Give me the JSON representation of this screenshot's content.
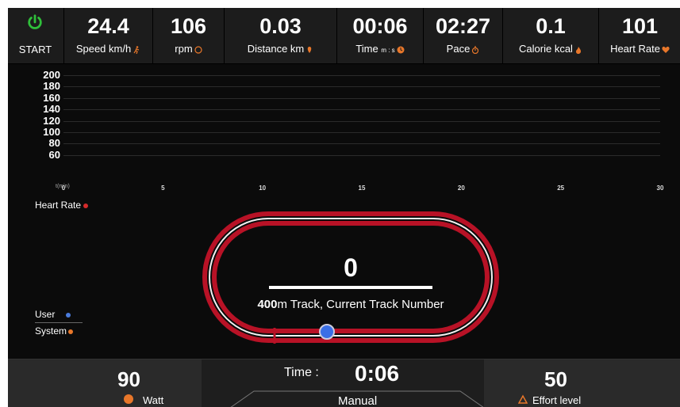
{
  "start": {
    "label": "START"
  },
  "stats": [
    {
      "value": "24.4",
      "label": "Speed km/h",
      "icon": "runner-icon"
    },
    {
      "value": "106",
      "label": "rpm",
      "icon": "rpm-icon"
    },
    {
      "value": "0.03",
      "label": "Distance km",
      "icon": "distance-icon"
    },
    {
      "value": "00:06",
      "label": "Time",
      "label_sub": "m : s",
      "icon": "clock-icon"
    },
    {
      "value": "02:27",
      "label": "Pace",
      "icon": "stopwatch-icon"
    },
    {
      "value": "0.1",
      "label": "Calorie kcal",
      "icon": "flame-icon"
    },
    {
      "value": "101",
      "label": "Heart Rate",
      "icon": "heart-icon"
    }
  ],
  "chart_data": {
    "type": "line",
    "ylabel": "Heart Rate",
    "xlabel": "t(min)",
    "y_ticks": [
      "200",
      "180",
      "160",
      "140",
      "120",
      "100",
      "80",
      "60"
    ],
    "x_ticks": [
      "0",
      "5",
      "10",
      "15",
      "20",
      "25",
      "30"
    ],
    "xlim": [
      0,
      30
    ],
    "ylim": [
      60,
      200
    ],
    "series": [],
    "grid": true
  },
  "chart_extra": {
    "x_unit": "t(min)",
    "axis_label": "Heart Rate"
  },
  "track": {
    "number": "0",
    "distance": "400",
    "caption_rest": "m Track, Current Track Number",
    "progress": 0.0
  },
  "legend": {
    "user": "User",
    "system": "System"
  },
  "bottom": {
    "watt_value": "90",
    "watt_label": "Watt",
    "time_label": "Time :",
    "time_value": "0:06",
    "mode": "Manual",
    "effort_value": "50",
    "effort_label": "Effort level"
  },
  "colors": {
    "accent": "#e8772a",
    "power": "#2fbf3a",
    "track": "#b81226",
    "user_dot": "#4a7bdc",
    "system_dot": "#e8772a"
  }
}
